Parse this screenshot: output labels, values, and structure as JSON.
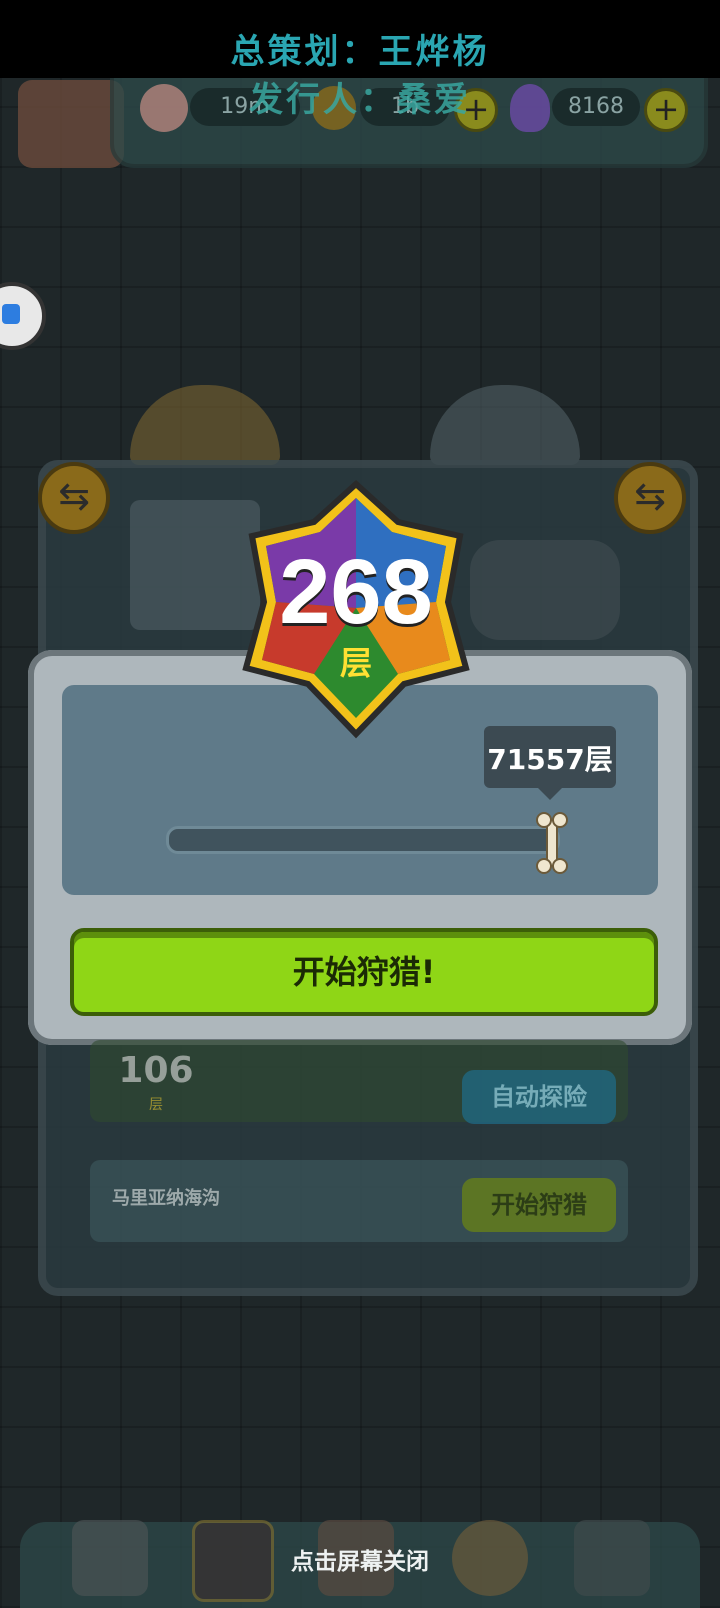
{
  "credits": {
    "line1": "总策划：王烨杨",
    "line2": "发行人：桑爱"
  },
  "resources": {
    "eyes": "19m",
    "coins": "1b",
    "potion": "8168"
  },
  "badge": {
    "floor": "268",
    "unit": "层"
  },
  "slider": {
    "tooltip": "71557层",
    "level": 1.0
  },
  "modal": {
    "start_label": "开始狩猎!"
  },
  "cards": {
    "card1_floor": "106",
    "card1_unit": "层",
    "card1_button": "自动探险",
    "card2_title": "马里亚纳海沟",
    "card2_button": "开始狩猎"
  },
  "footer": {
    "close_hint": "点击屏幕关闭"
  },
  "colors": {
    "credit_line1": "#2aa6b2",
    "credit_line2": "#39a7a0",
    "start_button": "#8fd616"
  },
  "icons": [
    "eyeball-icon",
    "coin-icon",
    "potion-icon",
    "plus-icon",
    "swap-icon",
    "bone-icon",
    "bag-icon",
    "grid-icon",
    "house-icon",
    "book-icon"
  ]
}
